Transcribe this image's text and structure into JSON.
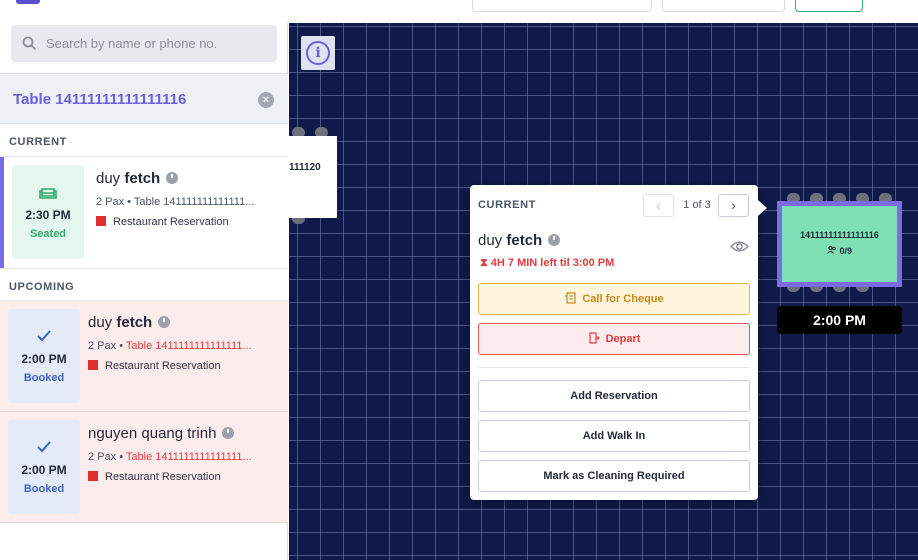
{
  "search": {
    "placeholder": "Search by name or phone no."
  },
  "table_filter": {
    "label": "Table 14111111111111116"
  },
  "sections": {
    "current": "CURRENT",
    "upcoming": "UPCOMING"
  },
  "current_reservation": {
    "time": "2:30 PM",
    "status": "Seated",
    "first_name": "duy ",
    "last_name": "fetch",
    "pax": "2 Pax",
    "table": "Table 141111111111111...",
    "source": "Restaurant Reservation"
  },
  "upcoming": [
    {
      "time": "2:00 PM",
      "status": "Booked",
      "first_name": "duy ",
      "last_name": "fetch",
      "pax": "2 Pax",
      "table": "Table 1411111111111111...",
      "source": "Restaurant Reservation"
    },
    {
      "time": "2:00 PM",
      "status": "Booked",
      "first_name": "nguyen quang trinh",
      "last_name": "",
      "pax": "2 Pax",
      "table": "Table 1411111111111111...",
      "source": "Restaurant Reservation"
    }
  ],
  "floor": {
    "left_table_label": "111120",
    "table_number": "14111111111111116",
    "occupancy": "0/9",
    "time_label": "2:00 PM"
  },
  "popover": {
    "heading": "CURRENT",
    "pager": "1 of 3",
    "first_name": "duy ",
    "last_name": "fetch",
    "timer": "4H 7 MIN left til 3:00 PM",
    "call_cheque": "Call for Cheque",
    "depart": "Depart",
    "add_reservation": "Add Reservation",
    "add_walk_in": "Add Walk In",
    "mark_cleaning": "Mark as Cleaning Required"
  },
  "colors": {
    "accent": "#6d5ee0",
    "seated": "#2fae6a",
    "booked": "#3d63c8",
    "alert": "#e03c3c",
    "floor_bg": "#0f1a4a",
    "table_fill": "#7ee0b4"
  }
}
